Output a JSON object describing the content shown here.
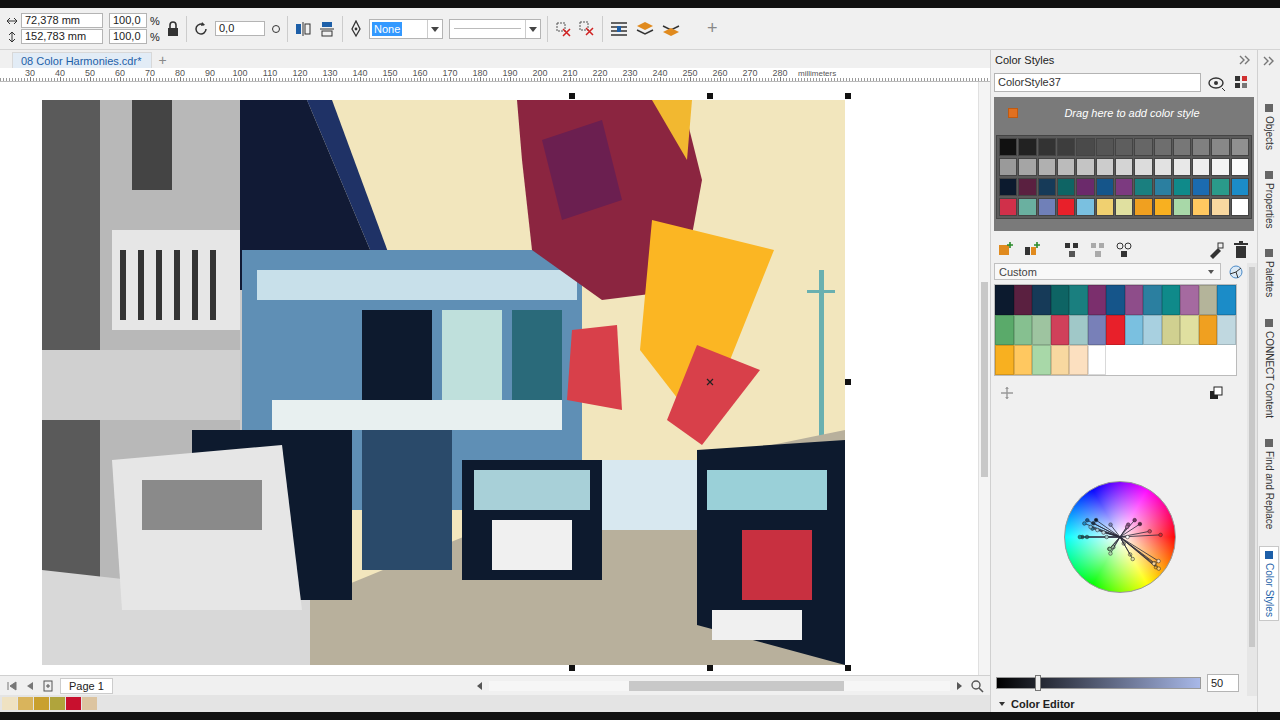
{
  "property_bar": {
    "object_size": [
      {
        "value": "72,378 mm"
      },
      {
        "value": "152,783 mm"
      }
    ],
    "scale_factor": [
      {
        "value": "100,0",
        "unit": "%"
      },
      {
        "value": "100,0",
        "unit": "%"
      }
    ],
    "rotation": "0,0",
    "outline_width": {
      "value": "None",
      "selected": true
    },
    "add_button": "+"
  },
  "document_tabs": [
    {
      "label": "08 Color Harmonies.cdr*",
      "selected": true
    }
  ],
  "new_tab_button": "+",
  "ruler": {
    "ticks": [
      "30",
      "40",
      "50",
      "60",
      "70",
      "80",
      "90",
      "100",
      "110",
      "120",
      "130",
      "140",
      "150",
      "160",
      "170",
      "180",
      "190",
      "200",
      "210",
      "220",
      "230",
      "240",
      "250",
      "260",
      "270",
      "280"
    ],
    "unit": "millimeters"
  },
  "page_nav": {
    "pages": [
      {
        "label": "Page 1",
        "selected": true
      }
    ]
  },
  "document_palette": [
    {
      "color": "#efe2c2"
    },
    {
      "color": "#d9b45c"
    },
    {
      "color": "#c9a02e"
    },
    {
      "color": "#b0a43c"
    },
    {
      "color": "#c8102e"
    },
    {
      "color": "#dcc4a0"
    }
  ],
  "docker": {
    "title": "Color Styles",
    "style_name": "ColorStyle37",
    "drop_hint": "Drag here to add color style",
    "style_swatches": [
      [
        {
          "color": "#111111"
        },
        {
          "color": "#222222"
        },
        {
          "color": "#333333"
        },
        {
          "color": "#3d3d3d"
        },
        {
          "color": "#4a4a4a"
        },
        {
          "color": "#555555"
        },
        {
          "color": "#5e5e5e"
        },
        {
          "color": "#666666"
        },
        {
          "color": "#6e6e6e"
        },
        {
          "color": "#777777"
        },
        {
          "color": "#808080"
        },
        {
          "color": "#888888"
        },
        {
          "color": "#909090"
        }
      ],
      [
        {
          "color": "#9a9a9a"
        },
        {
          "color": "#a5a5a5"
        },
        {
          "color": "#b0b0b0"
        },
        {
          "color": "#bbbbbb"
        },
        {
          "color": "#c4c4c4"
        },
        {
          "color": "#cccccc"
        },
        {
          "color": "#d4d4d4"
        },
        {
          "color": "#dcdcdc"
        },
        {
          "color": "#e2e2e2"
        },
        {
          "color": "#e8e8e8"
        },
        {
          "color": "#eeeeee"
        },
        {
          "color": "#f4f4f4"
        },
        {
          "color": "#fafafa"
        }
      ],
      [
        {
          "color": "#0c1a2e"
        },
        {
          "color": "#5a2040"
        },
        {
          "color": "#163a58"
        },
        {
          "color": "#0e6464"
        },
        {
          "color": "#6b2a6b"
        },
        {
          "color": "#15558a"
        },
        {
          "color": "#7c3a80"
        },
        {
          "color": "#1a7f7f"
        },
        {
          "color": "#2b7fa0"
        },
        {
          "color": "#0f8a8a"
        },
        {
          "color": "#1b6bb0"
        },
        {
          "color": "#2a9a8a"
        },
        {
          "color": "#1b8cc8"
        }
      ],
      [
        {
          "color": "#d0304a"
        },
        {
          "color": "#6ab0a0"
        },
        {
          "color": "#7080b8"
        },
        {
          "color": "#e8202a"
        },
        {
          "color": "#7ac0e0"
        },
        {
          "color": "#f0d070"
        },
        {
          "color": "#e0e0a0"
        },
        {
          "color": "#f0a020"
        },
        {
          "color": "#f8b020"
        },
        {
          "color": "#a8d8a8"
        },
        {
          "color": "#ffc860"
        },
        {
          "color": "#f8d8a0"
        },
        {
          "color": "#ffffff"
        }
      ]
    ],
    "harmony_rule": "Custom",
    "harmony_swatches": [
      {
        "color": "#0c1a2e"
      },
      {
        "color": "#5a2040"
      },
      {
        "color": "#163a58"
      },
      {
        "color": "#0e6464"
      },
      {
        "color": "#1a7f7f"
      },
      {
        "color": "#7b2f6d"
      },
      {
        "color": "#15558a"
      },
      {
        "color": "#8e4d8a"
      },
      {
        "color": "#2b7fa0"
      },
      {
        "color": "#0f8a8a"
      },
      {
        "color": "#a56aa0"
      },
      {
        "color": "#b4b49a"
      },
      {
        "color": "#1b8cc8"
      },
      {
        "color": "#5aaa6a"
      },
      {
        "color": "#86c090"
      },
      {
        "color": "#9ec4a0"
      },
      {
        "color": "#d0405a"
      },
      {
        "color": "#a0c8c8"
      },
      {
        "color": "#7880b8"
      },
      {
        "color": "#e8202a"
      },
      {
        "color": "#7ac0e0"
      },
      {
        "color": "#a8d0e0"
      },
      {
        "color": "#d0d090"
      },
      {
        "color": "#e0e0a0"
      },
      {
        "color": "#f0a020"
      },
      {
        "color": "#c0d8e0"
      },
      {
        "color": "#f8b020"
      },
      {
        "color": "#ffc860"
      },
      {
        "color": "#a8d8a8"
      },
      {
        "color": "#f8d8a0"
      },
      {
        "color": "#fce0c0"
      },
      {
        "color": "#ffffff"
      }
    ],
    "brightness": {
      "level": 0.2,
      "reading": "50"
    },
    "next_section": "Color Editor"
  },
  "side_tabs": [
    {
      "label": "Objects",
      "selected": false
    },
    {
      "label": "Properties",
      "selected": false
    },
    {
      "label": "Palettes",
      "selected": false
    },
    {
      "label": "CONNECT Content",
      "selected": false
    },
    {
      "label": "Find and Replace",
      "selected": false
    },
    {
      "label": "Color Styles",
      "selected": true
    }
  ]
}
